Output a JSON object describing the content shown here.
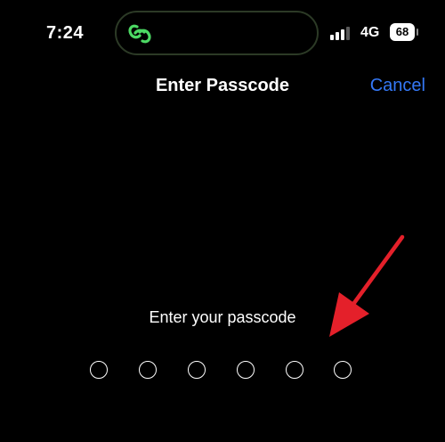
{
  "status_bar": {
    "time": "7:24",
    "network": "4G",
    "battery_level": "68",
    "signal_bars_filled": 3,
    "signal_bars_total": 4
  },
  "island": {
    "icon": "link-icon",
    "icon_color": "#4cd964"
  },
  "nav": {
    "title": "Enter Passcode",
    "cancel_label": "Cancel"
  },
  "passcode": {
    "prompt": "Enter your passcode",
    "length": 6,
    "entered": 0
  },
  "annotation": {
    "arrow_color": "#e4202a"
  },
  "colors": {
    "background": "#000000",
    "text": "#ffffff",
    "accent": "#3478f6"
  }
}
